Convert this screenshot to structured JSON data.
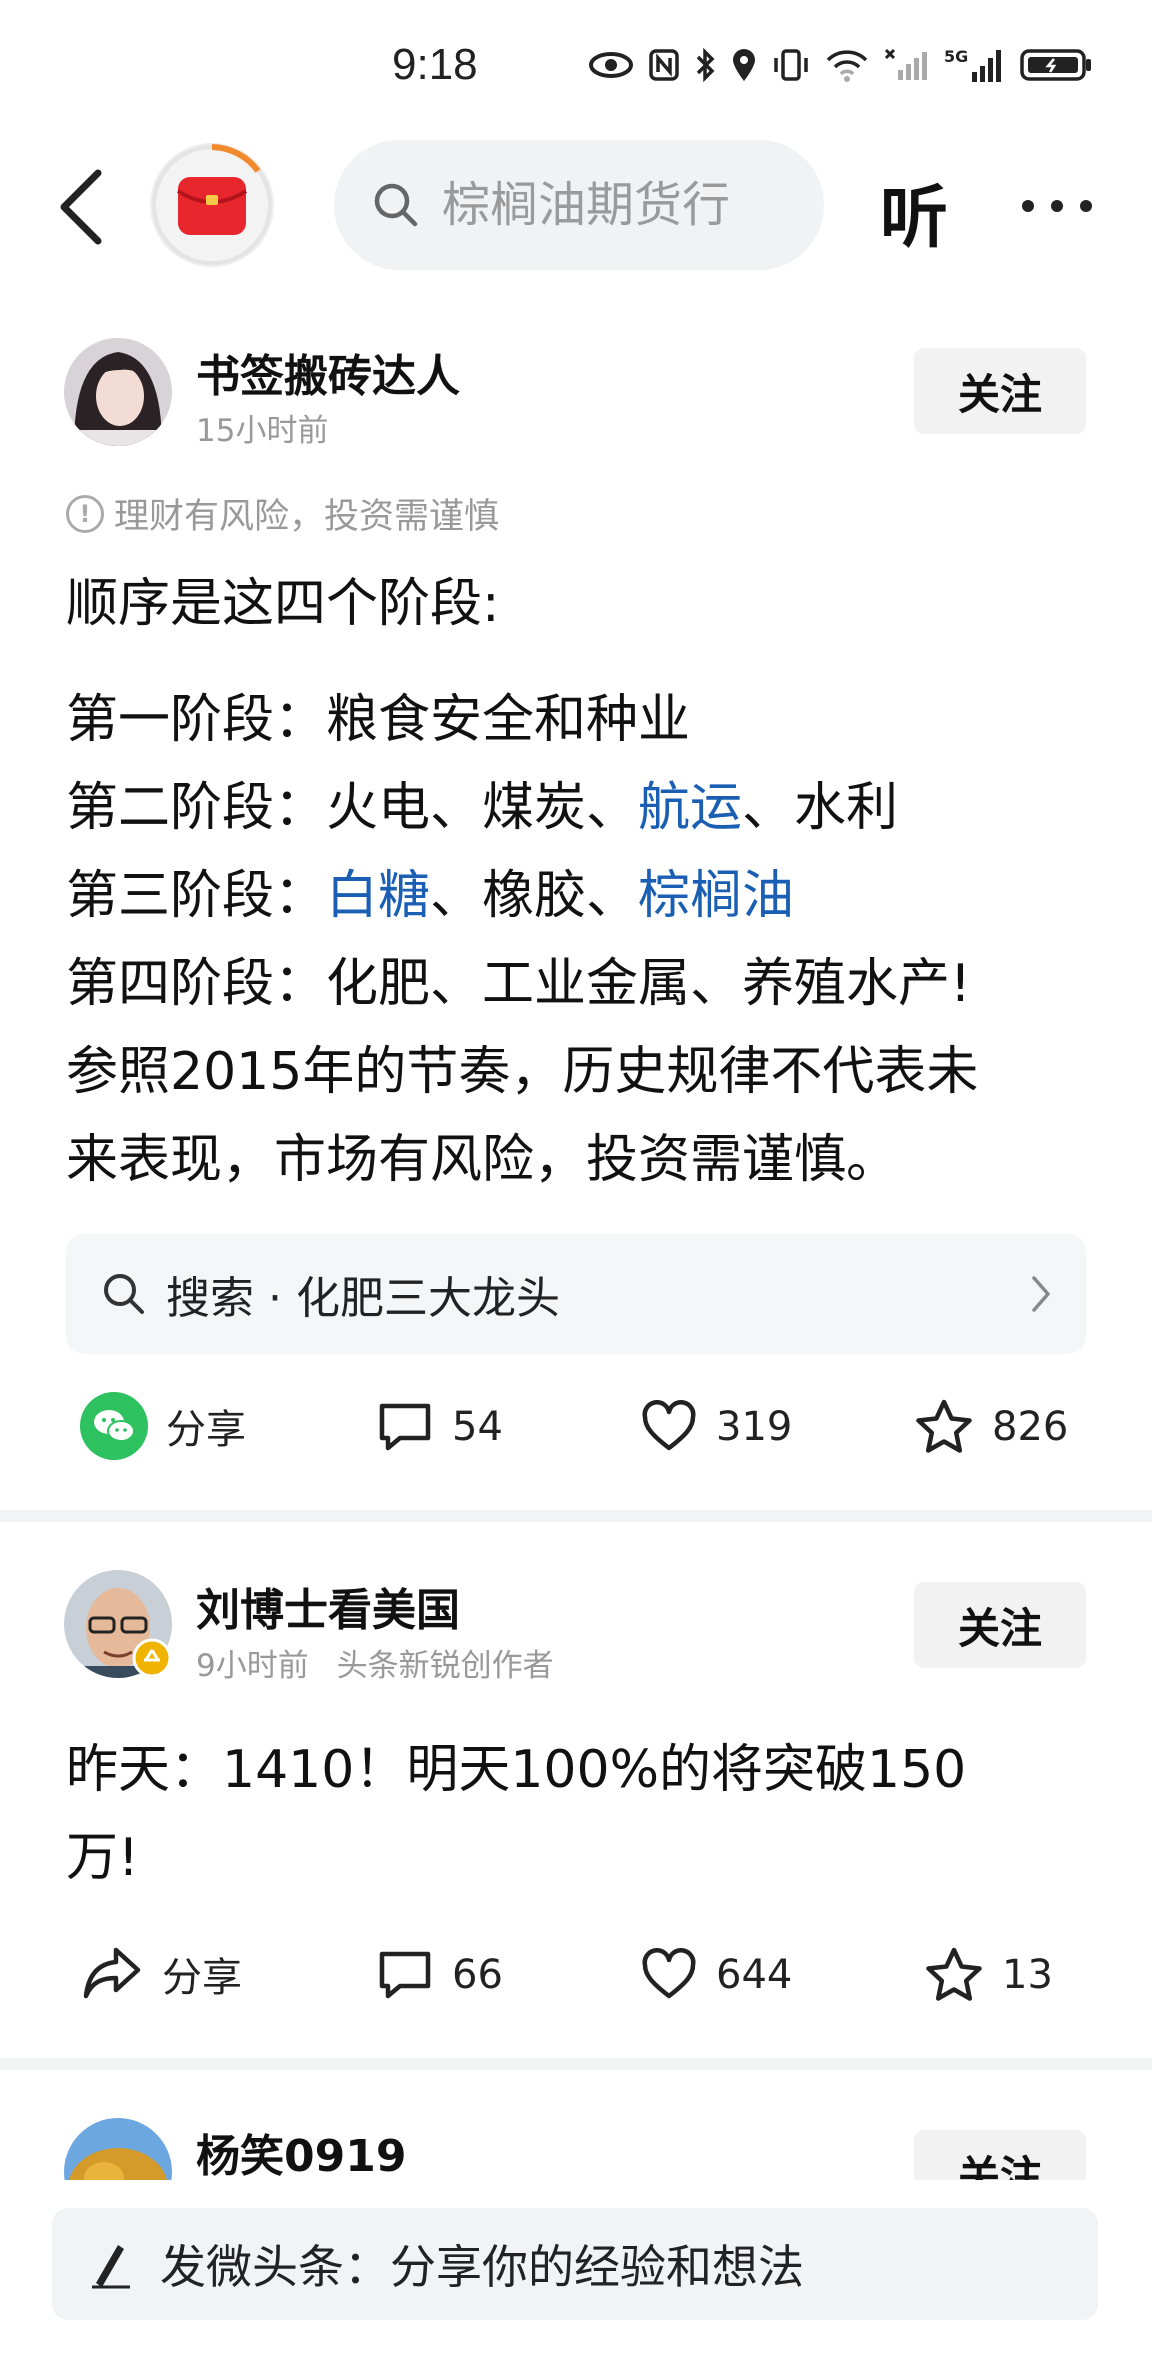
{
  "status_bar": {
    "time": "9:18",
    "network": "5G"
  },
  "top_nav": {
    "search_placeholder": "棕榈油期货行",
    "listen_label": "听"
  },
  "posts": [
    {
      "author": "书签搬砖达人",
      "time": "15小时前",
      "follow_label": "关注",
      "risk_notice": "理财有风险，投资需谨慎",
      "lines": [
        [
          {
            "t": "顺序是这四个阶段:"
          }
        ],
        [
          {
            "t": "第一阶段：粮食安全和种业"
          }
        ],
        [
          {
            "t": "第二阶段：火电、煤炭、"
          },
          {
            "t": "航运",
            "link": true
          },
          {
            "t": "、水利"
          }
        ],
        [
          {
            "t": "第三阶段："
          },
          {
            "t": "白糖",
            "link": true
          },
          {
            "t": "、橡胶、"
          },
          {
            "t": "棕榈油",
            "link": true
          }
        ],
        [
          {
            "t": "第四阶段：化肥、工业金属、养殖水产!"
          }
        ],
        [
          {
            "t": "参照2015年的节奏，历史规律不代表未"
          }
        ],
        [
          {
            "t": "来表现，市场有风险，投资需谨慎。"
          }
        ]
      ],
      "search_suggest": "搜索 · 化肥三大龙头",
      "share_label": "分享",
      "comments": "54",
      "likes": "319",
      "favorites": "826"
    },
    {
      "author": "刘博士看美国",
      "time": "9小时前",
      "badge_text": "头条新锐创作者",
      "follow_label": "关注",
      "lines": [
        [
          {
            "t": "昨天：1410！明天100%的将突破150"
          }
        ],
        [
          {
            "t": "万!"
          }
        ]
      ],
      "share_label": "分享",
      "comments": "66",
      "likes": "644",
      "favorites": "13"
    },
    {
      "author": "杨笑0919",
      "follow_label": "关注"
    }
  ],
  "compose_bar": {
    "placeholder": "发微头条：分享你的经验和想法"
  },
  "colors": {
    "link": "#1a5fb4",
    "wechat_green": "#2dc15f",
    "app_red": "#e8262e"
  }
}
